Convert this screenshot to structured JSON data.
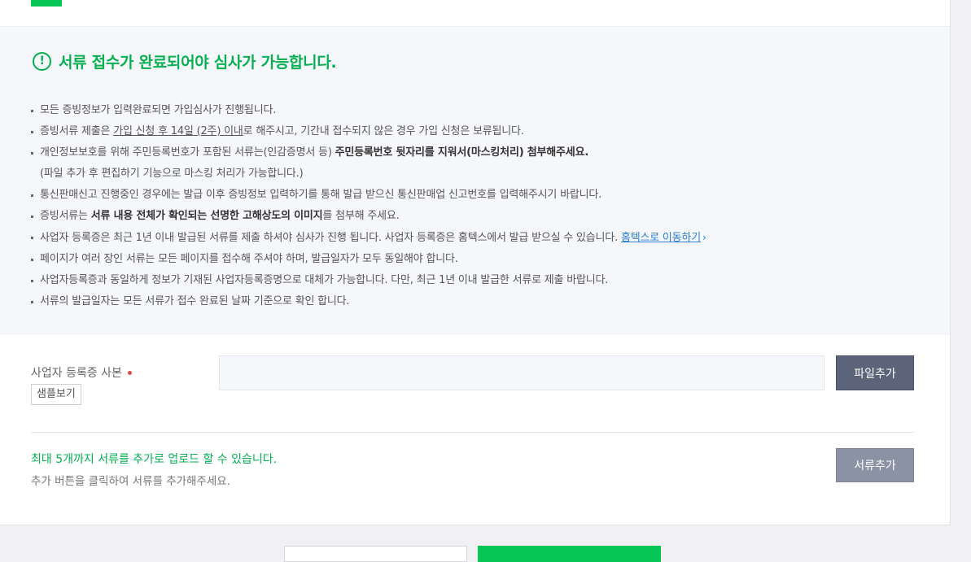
{
  "notice": {
    "title": "서류 접수가 완료되어야 심사가 가능합니다.",
    "icon": "exclamation-circle-icon",
    "items": {
      "i0": "모든 증빙정보가 입력완료되면 가입심사가 진행됩니다.",
      "i1_pre": "증빙서류 제출은 ",
      "i1_underline": "가입 신청 후 14일 (2주) 이내",
      "i1_post": "로 해주시고, 기간내 접수되지 않은 경우 가입 신청은 보류됩니다.",
      "i2_pre": "개인정보보호를 위해 주민등록번호가 포함된 서류는(인감증명서 등) ",
      "i2_bold": "주민등록번호 뒷자리를 지워서(마스킹처리) 첨부해주세요.",
      "i2_sub": "(파일 추가 후 편집하기 기능으로 마스킹 처리가 가능합니다.)",
      "i3": "통신판매신고 진행중인 경우에는 발급 이후 증빙정보 입력하기를 통해 발급 받으신 통신판매업 신고번호를 입력해주시기 바랍니다.",
      "i4_pre": "증빙서류는 ",
      "i4_bold": "서류 내용 전체가 확인되는 선명한 고해상도의 이미지",
      "i4_post": "를 첨부해 주세요.",
      "i5_pre": "사업자 등록증은 최근 1년 이내 발급된 서류를 제출 하셔야 심사가 진행 됩니다. 사업자 등록증은 홈텍스에서 발급 받으실 수 있습니다. ",
      "i5_link": "홈텍스로 이동하기",
      "i6": "페이지가 여러 장인 서류는 모든 페이지를 접수해 주셔야 하며, 발급일자가 모두 동일해야 합니다.",
      "i7": "사업자등록증과 동일하게 정보가 기재된 사업자등록증명으로 대체가 가능합니다. 다만, 최근 1년 이내 발급한 서류로 제출 바랍니다.",
      "i8": "서류의 발급일자는 모든 서류가 접수 완료된 날짜 기준으로 확인 합니다."
    }
  },
  "upload": {
    "field_label": "사업자 등록증 사본",
    "sample_button": "샘플보기",
    "file_value": "",
    "add_file_button": "파일추가",
    "info_green": "최대 5개까지 서류를 추가로 업로드 할 수 있습니다.",
    "info_gray": "추가 버튼을 클릭하여 서류를 추가해주세요.",
    "add_doc_button": "서류추가"
  },
  "colors": {
    "accent_green": "#06c755",
    "required": "#e84545",
    "link": "#2a7fd4"
  }
}
